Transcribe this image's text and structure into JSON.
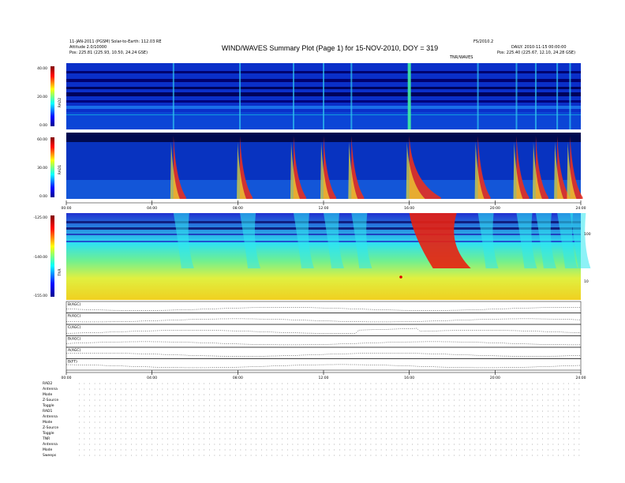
{
  "title": "WIND/WAVES Summary Plot (Page 1) for 15-NOV-2010, DOY = 319",
  "header": {
    "left1": "11-JAN-2011 (PGSM) Solar-to-Earth: 112.03 RE",
    "left2": "Attitude 2.0/10000",
    "left3": "Pos: 225.81 (225.93, 10.50, 24.24 GSE)",
    "right_top": "FS/2010.2",
    "right1": "DAILY: 2010-11-15 00:00:00",
    "right2": "Pos: 225.40 (225.67, 12.10, 24.28 GSE)",
    "mid_label": "TNR/WAVES"
  },
  "chart_data": {
    "type": "heatmap",
    "panels": [
      {
        "id": "rad2",
        "label": "RAD2",
        "ticks": [
          "40.00",
          "20.00",
          "0.00"
        ]
      },
      {
        "id": "rad1",
        "label": "RAD1",
        "ticks": [
          "60.00",
          "30.00",
          "0.00"
        ]
      },
      {
        "id": "tnr",
        "label": "TNR",
        "ticks": [
          "-125.00",
          "-140.00",
          "-155.00"
        ]
      }
    ],
    "time_ticks_top": [
      "00:00",
      "04:00",
      "08:00",
      "12:00",
      "16:00",
      "20:00",
      "24:00"
    ],
    "time_ticks_bottom": [
      "00:00",
      "04:00",
      "08:00",
      "12:00",
      "16:00",
      "20:00",
      "24:00"
    ],
    "tnr_right_ticks": [
      "100",
      "10"
    ],
    "bursts_hours": [
      5.0,
      8.1,
      10.6,
      12.0,
      13.3,
      16.0,
      19.2,
      21.0,
      21.9,
      22.9,
      23.5
    ],
    "line_panels": [
      "B(AGC)",
      "R(AGC)",
      "C(AGC)",
      "B(AGC)",
      "A(AGC)",
      "B(FT)"
    ]
  },
  "footer": {
    "rad2": [
      "RAD2",
      "Antenna",
      "Mode",
      "Z-Source",
      "Toggle"
    ],
    "rad1": [
      "RAD1",
      "Antenna",
      "Mode",
      "Z-Source",
      "Toggle"
    ],
    "tnr": [
      "TNR",
      "Antenna",
      "Mode",
      "Sweeps"
    ]
  }
}
